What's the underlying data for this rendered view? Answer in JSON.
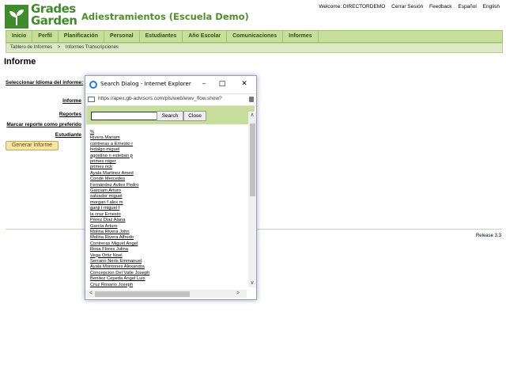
{
  "header": {
    "logo_line1": "Grades",
    "logo_line2": "Garden",
    "title": "Adiestramientos (Escuela Demo)",
    "links": [
      "Welcome: DIRECTORDEMO",
      "Cerrar Sesión",
      "Feedback",
      "Español",
      "English"
    ]
  },
  "nav": [
    "Inicio",
    "Perfil",
    "Planificación",
    "Personal",
    "Estudiantes",
    "Año Escolar",
    "Comunicaciones",
    "Informes"
  ],
  "breadcrumb": [
    "Tablero de Informes",
    ">",
    "Informes Transcripciones"
  ],
  "page_title": "Informe",
  "form": {
    "language_label": "Seleccionar Idioma del informe:",
    "report_label": "Informe",
    "reports_label": "Reportes",
    "mark_default_label": "Marcar reporte como preferido",
    "student_label": "Estudiante",
    "generate_button": "Generar Informe"
  },
  "footer": {
    "release": "Release 3.3"
  },
  "dialog": {
    "title": "Search Dialog - Internet Explorer",
    "address": "https://apex.gb-advisors.com/pls/web/wwv_flow.show?",
    "search_value": "",
    "search_button": "Search",
    "close_button": "Close",
    "items": [
      "%",
      "Rivera Mariam",
      "contreras a Ernesto r",
      "hidalgo miguel",
      "agostino n esteban p",
      "primes roger",
      "primes rick",
      "Ayala Martinez Amed",
      "Conde Mercedes",
      "Fernández Aviles Pedro",
      "Garciam Arturo",
      "salvador miguel",
      "morgan f alex m",
      "ganji t miguel f",
      "la cruz Ernesto",
      "Pérez Diaz Alana",
      "García Arturo",
      "Molina Rivera John",
      "Molina Rivera Alfredo",
      "Contreras Miguel Angel",
      "Rosa Flores Julina",
      "Vega Ortiz Noel",
      "Serrano Neris Emmanuel",
      "Ayala Montones Alexandra",
      "Concepcion Del Valle Joseph",
      "Benitez Cepeda Angel Luis",
      "Cruz Rosario Joseph"
    ]
  }
}
